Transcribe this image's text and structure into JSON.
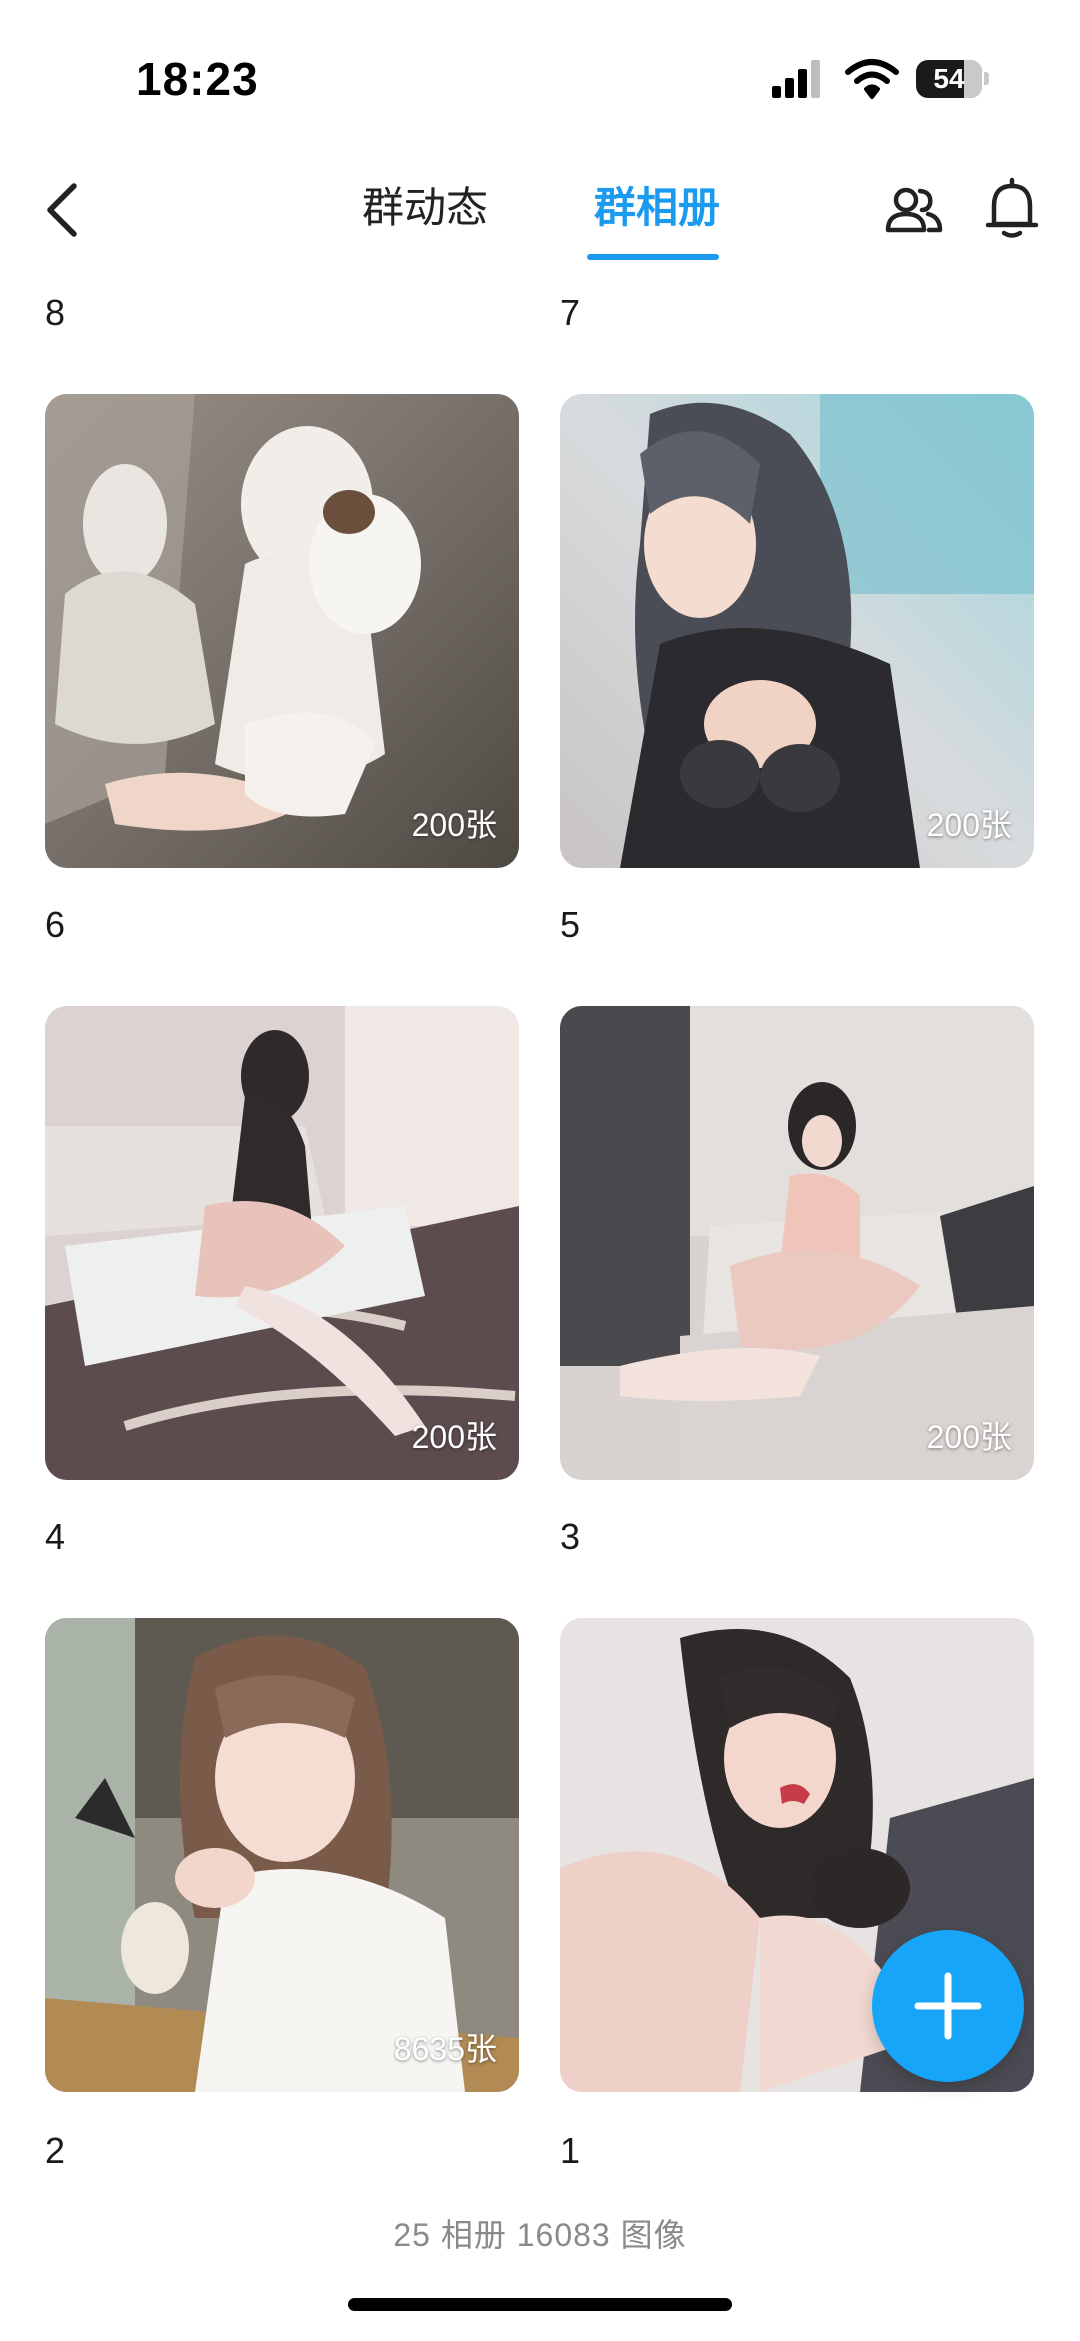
{
  "status_bar": {
    "time": "18:23",
    "battery": "54",
    "icons": [
      "cellular-signal-icon",
      "wifi-icon",
      "battery-icon"
    ]
  },
  "header": {
    "tabs": [
      {
        "label": "群动态",
        "active": false
      },
      {
        "label": "群相册",
        "active": true
      }
    ],
    "icons": [
      "back-chevron-icon",
      "members-icon",
      "bell-icon"
    ],
    "accent_color": "#1a9bf0"
  },
  "albums": [
    {
      "label": "8",
      "count": "200张"
    },
    {
      "label": "7",
      "count": "200张"
    },
    {
      "label": "6",
      "count": "200张"
    },
    {
      "label": "5",
      "count": "200张"
    },
    {
      "label": "4",
      "count": "8635张"
    },
    {
      "label": "3",
      "count": ""
    },
    {
      "label": "2",
      "count": ""
    },
    {
      "label": "1",
      "count": ""
    }
  ],
  "footer": {
    "summary": "25 相册   16083 图像"
  },
  "fab": {
    "icon": "plus-icon",
    "color": "#16a5f8"
  }
}
